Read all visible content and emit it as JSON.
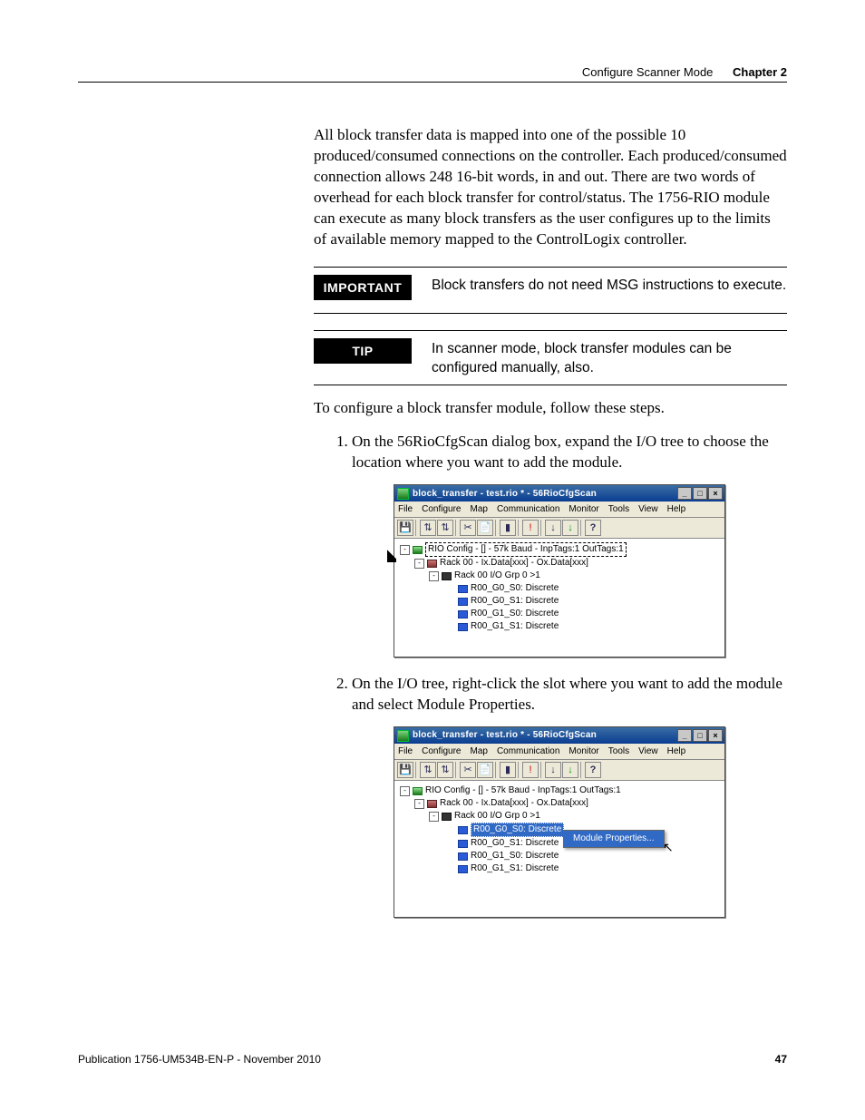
{
  "header": {
    "running_title": "Configure Scanner Mode",
    "chapter": "Chapter 2"
  },
  "body": {
    "intro_para": "All block transfer data is mapped into one of the possible 10 produced/consumed connections on the controller. Each produced/consumed connection allows 248 16-bit words, in and out. There are two words of overhead for each block transfer for control/status. The 1756-RIO module can execute as many block transfers as the user configures up to the limits of available memory mapped to the ControlLogix controller.",
    "important_label": "IMPORTANT",
    "important_text": "Block transfers do not need MSG instructions to execute.",
    "tip_label": "TIP",
    "tip_text": "In scanner mode, block transfer modules can be configured manually, also.",
    "lead": "To configure a block transfer module, follow these steps.",
    "steps": [
      "On the 56RioCfgScan dialog box, expand the I/O tree to choose the location where you want to add the module.",
      "On the I/O tree, right-click the slot where you want to add the module and select Module Properties."
    ]
  },
  "screenshot_common": {
    "window_title": "block_transfer - test.rio * - 56RioCfgScan",
    "menus": [
      "File",
      "Configure",
      "Map",
      "Communication",
      "Monitor",
      "Tools",
      "View",
      "Help"
    ],
    "tree_root": "RIO Config - [] - 57k Baud - InpTags:1 OutTags:1",
    "tree_rack": "Rack 00 - Ix.Data[xxx] - Ox.Data[xxx]",
    "tree_grp": "Rack 00 I/O Grp 0 >1",
    "tree_slots": [
      "R00_G0_S0: Discrete",
      "R00_G0_S1: Discrete",
      "R00_G1_S0: Discrete",
      "R00_G1_S1: Discrete"
    ]
  },
  "screenshot2": {
    "context_menu_item": "Module Properties..."
  },
  "footer": {
    "pub": "Publication 1756-UM534B-EN-P - November 2010",
    "page": "47"
  }
}
